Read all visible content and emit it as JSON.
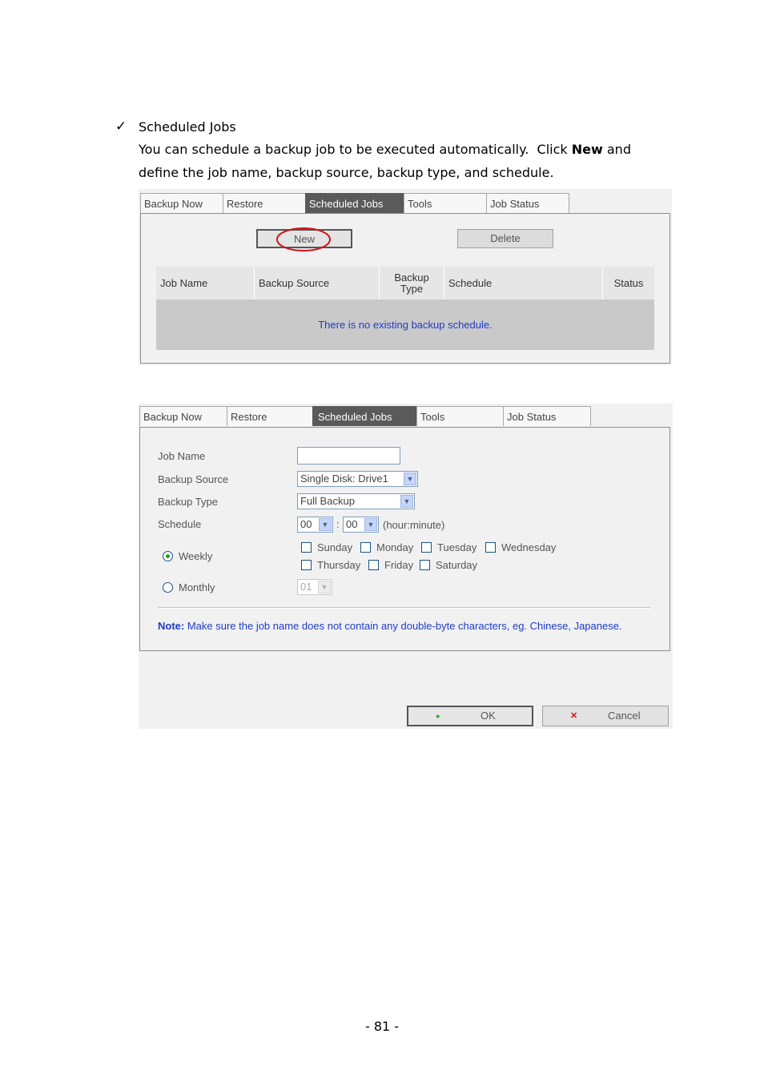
{
  "intro": {
    "check_mark": "✓",
    "heading": "Scheduled Jobs",
    "line1_before": "You can schedule a backup job to be executed automatically.  Click ",
    "line1_bold": "New",
    "line1_after": " and",
    "line2": "define the job name, backup source, backup type, and schedule."
  },
  "tabs": [
    "Backup Now",
    "Restore",
    "Scheduled Jobs",
    "Tools",
    "Job Status"
  ],
  "list_view": {
    "new_button": "New",
    "delete_button": "Delete",
    "columns": [
      "Job Name",
      "Backup Source",
      "Backup\nType",
      "Schedule",
      "Status"
    ],
    "empty_message": "There is no existing backup schedule."
  },
  "form_view": {
    "labels": {
      "job_name": "Job Name",
      "backup_source": "Backup Source",
      "backup_type": "Backup Type",
      "schedule": "Schedule",
      "weekly": "Weekly",
      "monthly": "Monthly"
    },
    "job_name_value": "",
    "backup_source_value": "Single Disk: Drive1",
    "backup_type_value": "Full Backup",
    "hour_value": "00",
    "minute_value": "00",
    "time_separator": ":",
    "time_hint": "(hour:minute)",
    "day_of_month_value": "01",
    "days_row1": [
      "Sunday",
      "Monday",
      "Tuesday",
      "Wednesday"
    ],
    "days_row2": [
      "Thursday",
      "Friday",
      "Saturday"
    ],
    "note_label": "Note:",
    "note_text": " Make sure the job name does not contain any double-byte characters, eg. Chinese, Japanese.",
    "ok_button": "OK",
    "cancel_button": "Cancel",
    "ok_icon": "●",
    "cancel_icon": "✕",
    "accent": "#1e3cc8",
    "highlight_circle": "#d0141c"
  },
  "page_number": "- 81 -"
}
